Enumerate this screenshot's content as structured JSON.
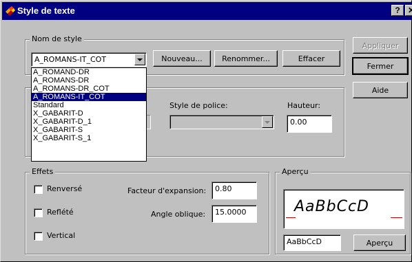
{
  "window": {
    "title": "Style de texte",
    "help_glyph": "?",
    "close_glyph": "✕"
  },
  "style_group": {
    "legend": "Nom de style",
    "selected": "A_ROMANS-IT_COT",
    "new_label": "Nouveau...",
    "rename_label": "Renommer...",
    "delete_label": "Effacer",
    "dropdown_options": [
      "A_ROMAND-DR",
      "A_ROMANS-DR",
      "A_ROMANS-DR_COT",
      "A_ROMANS-IT_COT",
      "Standard",
      "X_GABARIT-D",
      "X_GABARIT-D_1",
      "X_GABARIT-S",
      "X_GABARIT-S_1"
    ],
    "highlighted_index": 3
  },
  "side_buttons": {
    "apply": "Appliquer",
    "close": "Fermer",
    "help": "Aide"
  },
  "font_group": {
    "font_style_label": "Style de police:",
    "height_label": "Hauteur:",
    "height_value": "0.00"
  },
  "effects_group": {
    "legend": "Effets",
    "upside_down": "Renversé",
    "backwards": "Reflété",
    "vertical": "Vertical",
    "width_factor_label": "Facteur d'expansion:",
    "width_factor_value": "0.80",
    "oblique_label": "Angle oblique:",
    "oblique_value": "15.0000"
  },
  "preview_group": {
    "legend": "Aperçu",
    "sample": "AaBbCcD",
    "input_value": "AaBbCcD",
    "button": "Aperçu"
  },
  "colors": {
    "titlebar": "#000080",
    "face": "#c0c0c0",
    "selection": "#000080",
    "preview_line": "#d00000"
  }
}
